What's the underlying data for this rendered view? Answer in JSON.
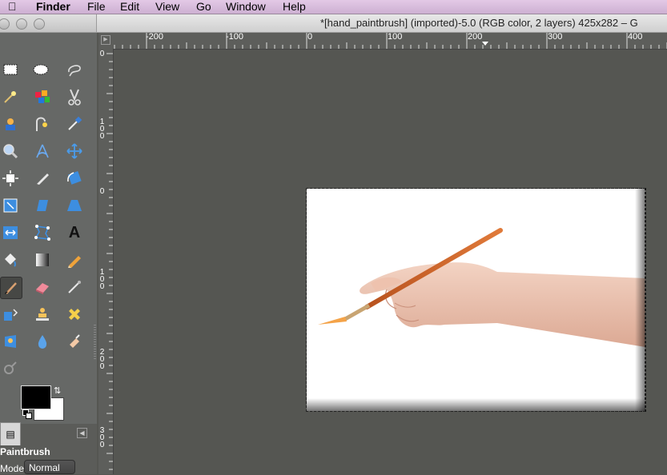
{
  "menubar": {
    "apple_icon": "apple-icon",
    "items": [
      "Finder",
      "File",
      "Edit",
      "View",
      "Go",
      "Window",
      "Help"
    ]
  },
  "window": {
    "title": "*[hand_paintbrush] (imported)-5.0 (RGB color, 2 layers) 425x282 – G"
  },
  "rulers": {
    "horizontal_labels": [
      "-200",
      "-100",
      "0",
      "100",
      "200",
      "300",
      "400"
    ],
    "vertical_labels": [
      [
        "0"
      ],
      [
        "1",
        "0",
        "0"
      ],
      [
        "0"
      ],
      [
        "1",
        "0",
        "0"
      ],
      [
        "2",
        "0",
        "0"
      ],
      [
        "3",
        "0",
        "0"
      ]
    ]
  },
  "toolbox": {
    "tools": [
      "rect-select-icon",
      "ellipse-select-icon",
      "free-select-icon",
      "fuzzy-select-icon",
      "select-by-color-icon",
      "scissors-select-icon",
      "foreground-select-icon",
      "paths-icon",
      "color-picker-icon",
      "zoom-icon",
      "measure-icon",
      "move-icon",
      "align-icon",
      "crop-icon",
      "rotate-icon",
      "scale-icon",
      "shear-icon",
      "perspective-icon",
      "flip-icon",
      "cage-transform-icon",
      "text-icon",
      "bucket-fill-icon",
      "blend-icon",
      "pencil-icon",
      "paintbrush-icon",
      "eraser-icon",
      "airbrush-icon",
      "ink-icon",
      "clone-icon",
      "heal-icon",
      "perspective-clone-icon",
      "blur-icon",
      "smudge-icon",
      "dodge-burn-icon"
    ],
    "active_tool": "paintbrush-icon",
    "foreground_color": "#000000",
    "background_color": "#ffffff"
  },
  "tool_options": {
    "tool_name": "Paintbrush",
    "mode_label": "Mode:",
    "mode_value": "Normal"
  },
  "canvas": {
    "image_description_label": "hand holding paintbrush"
  }
}
